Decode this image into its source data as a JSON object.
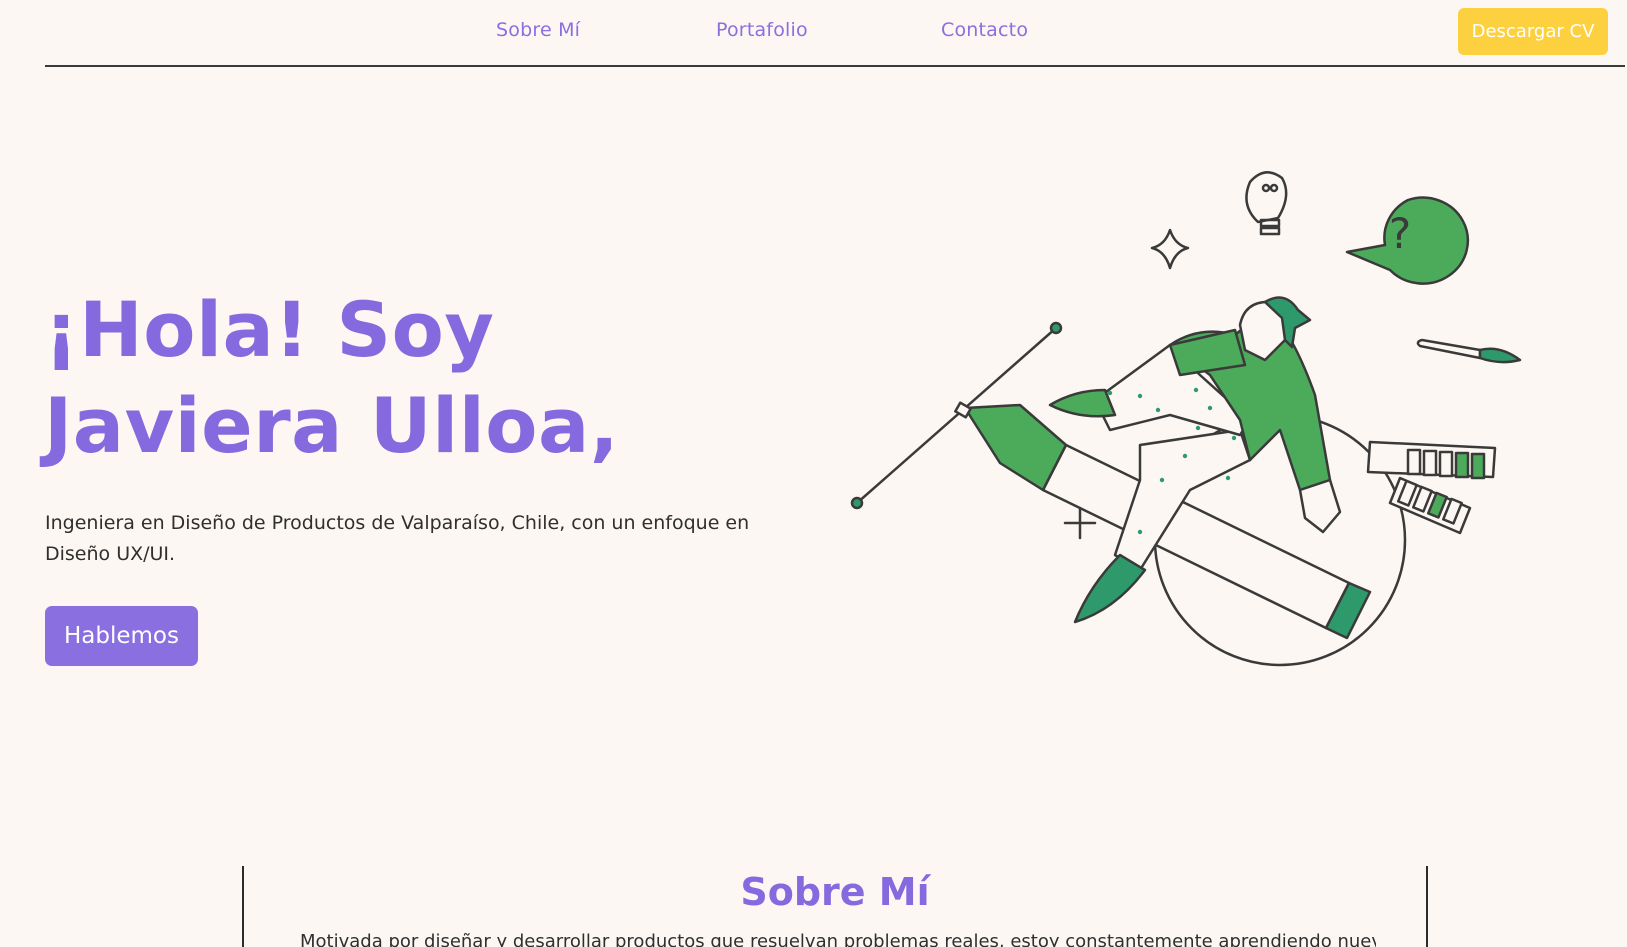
{
  "nav": {
    "links": [
      "Sobre Mí",
      "Portafolio",
      "Contacto"
    ],
    "cv_button": "Descargar CV"
  },
  "hero": {
    "title": "¡Hola! Soy Javiera Ulloa,",
    "subtitle": "Ingeniera en Diseño de Productos de Valparaíso, Chile, con un enfoque en Diseño UX/UI.",
    "cta": "Hablemos",
    "illustration_icon": "designer-riding-pen-illustration",
    "question_mark": "?"
  },
  "about": {
    "title": "Sobre Mí",
    "text": "Motivada por diseñar y desarrollar productos que resuelvan problemas reales, estoy constantemente aprendiendo nuevas"
  },
  "colors": {
    "background": "#fcf7f2",
    "accent_purple": "#8a6fe0",
    "accent_yellow": "#fcd03e",
    "illustration_green": "#4caa5b",
    "illustration_dark_green": "#2e9a6c"
  }
}
